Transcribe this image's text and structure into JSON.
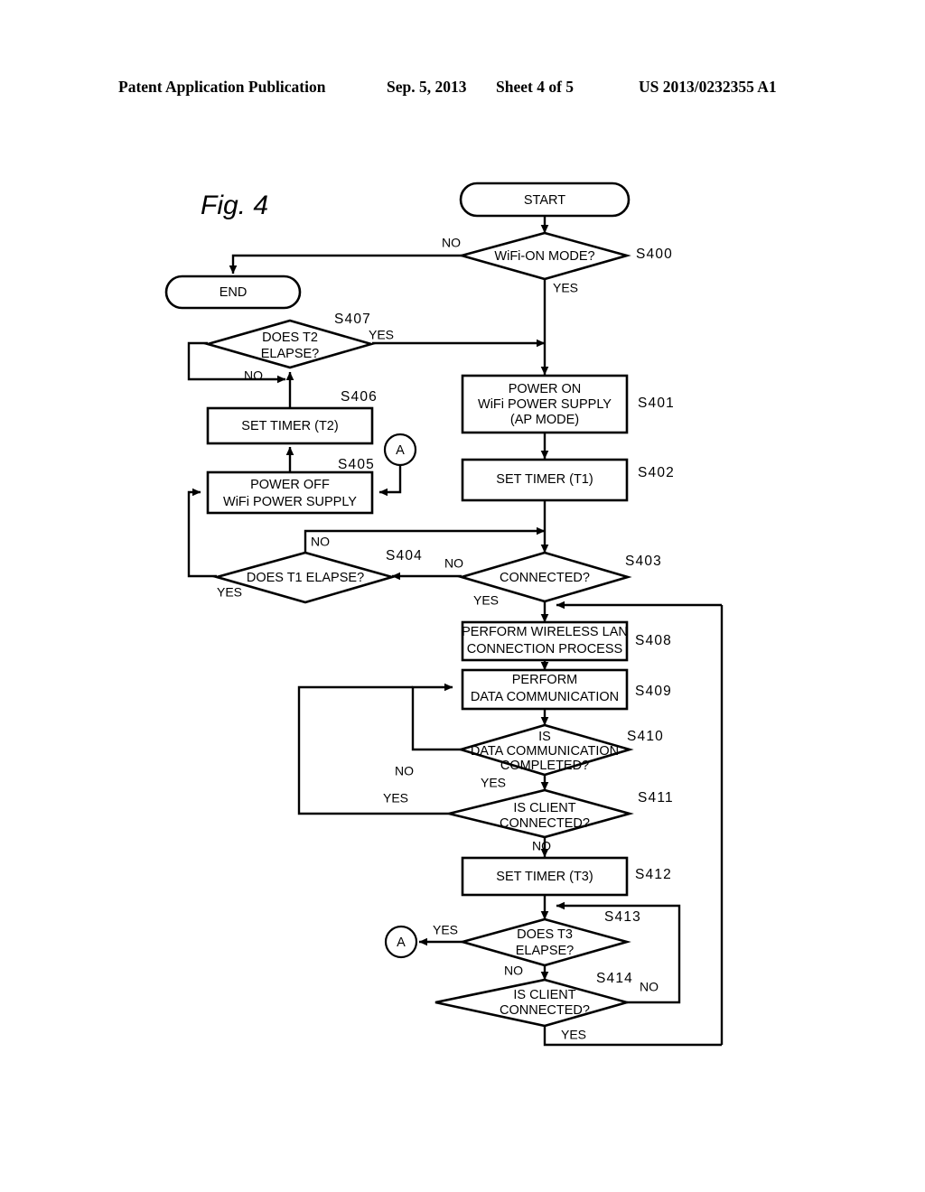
{
  "header": {
    "publication": "Patent Application Publication",
    "date": "Sep. 5, 2013",
    "sheet": "Sheet 4 of 5",
    "number": "US 2013/0232355 A1"
  },
  "figure": {
    "label": "Fig. 4"
  },
  "nodes": {
    "start": "START",
    "end": "END",
    "s400": "WiFi-ON MODE?",
    "s401_l1": "POWER ON",
    "s401_l2": "WiFi POWER SUPPLY",
    "s401_l3": "(AP MODE)",
    "s402": "SET TIMER (T1)",
    "s403": "CONNECTED?",
    "s404": "DOES T1 ELAPSE?",
    "s405_l1": "POWER OFF",
    "s405_l2": "WiFi POWER SUPPLY",
    "s406": "SET TIMER (T2)",
    "s407_l1": "DOES T2",
    "s407_l2": "ELAPSE?",
    "s408_l1": "PERFORM WIRELESS LAN",
    "s408_l2": "CONNECTION PROCESS",
    "s409_l1": "PERFORM",
    "s409_l2": "DATA COMMUNICATION",
    "s410_l1": "IS",
    "s410_l2": "DATA COMMUNICATION",
    "s410_l3": "COMPLETED?",
    "s411_l1": "IS CLIENT",
    "s411_l2": "CONNECTED?",
    "s412": "SET TIMER (T3)",
    "s413_l1": "DOES T3",
    "s413_l2": "ELAPSE?",
    "s414_l1": "IS CLIENT",
    "s414_l2": "CONNECTED?",
    "connector_a_top": "A",
    "connector_a_bottom": "A"
  },
  "step_labels": {
    "s400": "S400",
    "s401": "S401",
    "s402": "S402",
    "s403": "S403",
    "s404": "S404",
    "s405": "S405",
    "s406": "S406",
    "s407": "S407",
    "s408": "S408",
    "s409": "S409",
    "s410": "S410",
    "s411": "S411",
    "s412": "S412",
    "s413": "S413",
    "s414": "S414"
  },
  "branch_labels": {
    "s400_no": "NO",
    "s400_yes": "YES",
    "s407_yes": "YES",
    "s407_no": "NO",
    "s404_no": "NO",
    "s404_yes": "YES",
    "s403_no": "NO",
    "s403_yes": "YES",
    "s410_no": "NO",
    "s410_yes": "YES",
    "s411_yes": "YES",
    "s411_no": "NO",
    "s413_yes": "YES",
    "s413_no": "NO",
    "s414_no": "NO",
    "s414_yes": "YES"
  },
  "colors": {
    "stroke": "#000000",
    "background": "#ffffff"
  }
}
